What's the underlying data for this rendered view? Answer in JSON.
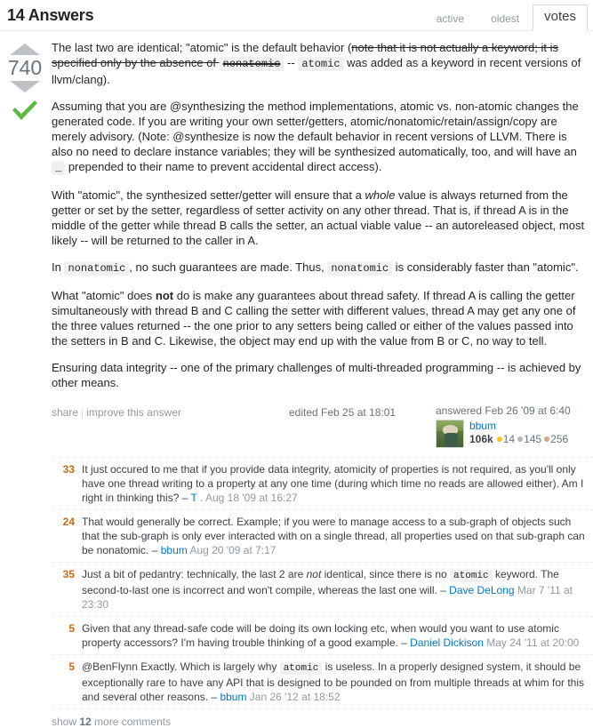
{
  "header": {
    "title": "14 Answers",
    "tabs": [
      {
        "label": "active",
        "active": false
      },
      {
        "label": "oldest",
        "active": false
      },
      {
        "label": "votes",
        "active": true
      }
    ]
  },
  "answer": {
    "vote_count": "740",
    "accepted": true,
    "accepted_color": "#5eba43",
    "paragraphs": {
      "p1_a": "The last two are identical; \"atomic\" is the default behavior (",
      "p1_strike_a": "note that it is not actually a keyword; it is specified only by the absence of ",
      "p1_strike_code": "nonatomic",
      "p1_b": " -- ",
      "p1_code": "atomic",
      "p1_c": " was added as a keyword in recent versions of llvm/clang).",
      "p2_a": "Assuming that you are @synthesizing the method implementations, atomic vs. non-atomic changes the generated code. If you are writing your own setter/getters, atomic/nonatomic/retain/assign/copy are merely advisory. (Note: @synthesize is now the default behavior in recent versions of LLVM. There is also no need to declare instance variables; they will be synthesized automatically, too, and will have an ",
      "p2_code": "_",
      "p2_b": " prepended to their name to prevent accidental direct access).",
      "p3_a": "With \"atomic\", the synthesized setter/getter will ensure that a ",
      "p3_ital": "whole",
      "p3_b": " value is always returned from the getter or set by the setter, regardless of setter activity on any other thread. That is, if thread A is in the middle of the getter while thread B calls the setter, an actual viable value -- an autoreleased object, most likely -- will be returned to the caller in A.",
      "p4_a": "In ",
      "p4_code1": "nonatomic",
      "p4_b": ", no such guarantees are made. Thus, ",
      "p4_code2": "nonatomic",
      "p4_c": " is considerably faster than \"atomic\".",
      "p5_a": "What \"atomic\" does ",
      "p5_bold": "not",
      "p5_b": " do is make any guarantees about thread safety. If thread A is calling the getter simultaneously with thread B and C calling the setter with different values, thread A may get any one of the three values returned -- the one prior to any setters being called or either of the values passed into the setters in B and C. Likewise, the object may end up with the value from B or C, no way to tell.",
      "p6": "Ensuring data integrity -- one of the primary challenges of multi-threaded programming -- is achieved by other means."
    },
    "footer": {
      "share_label": "share",
      "improve_label": "improve this answer",
      "edited_label": "edited Feb 25 at 18:01",
      "answered_label": "answered Feb 26 '09 at 6:40"
    },
    "user": {
      "name": "bbum",
      "reputation": "106k",
      "gold": "14",
      "silver": "145",
      "bronze": "256"
    }
  },
  "comments": [
    {
      "score": "33",
      "parts": [
        {
          "t": "text",
          "v": "It just occured to me that if you provide data integrity, atomicity of properties is not required, as you'll only have one thread writing to a property at any one time (during which time no reads are allowed either). Am I right in thinking this? "
        },
        {
          "t": "dash",
          "v": "– "
        },
        {
          "t": "user",
          "v": "T"
        },
        {
          "t": "date",
          "v": " . Aug 18 '09 at 16:27"
        }
      ]
    },
    {
      "score": "24",
      "parts": [
        {
          "t": "text",
          "v": "That would generally be correct. Example; if you were to manage access to a sub-graph of objects such that the sub-graph is only ever interacted with on a single thread, all properties used on that sub-graph can be nonatomic. "
        },
        {
          "t": "dash",
          "v": "– "
        },
        {
          "t": "user",
          "v": "bbum"
        },
        {
          "t": "date",
          "v": " Aug 20 '09 at 7:17"
        }
      ]
    },
    {
      "score": "35",
      "parts": [
        {
          "t": "text",
          "v": "Just a bit of pedantry: technically, the last 2 are "
        },
        {
          "t": "ital",
          "v": "not"
        },
        {
          "t": "text",
          "v": " identical, since there is no "
        },
        {
          "t": "code",
          "v": "atomic"
        },
        {
          "t": "text",
          "v": " keyword. The second-to-last one is incorrect and won't compile, whereas the last one will. "
        },
        {
          "t": "dash",
          "v": "– "
        },
        {
          "t": "user",
          "v": "Dave DeLong"
        },
        {
          "t": "date",
          "v": " Mar 7 '11 at 23:30"
        }
      ]
    },
    {
      "score": "5",
      "parts": [
        {
          "t": "text",
          "v": "Given that any thread-safe code will be doing its own locking etc, when would you want to use atomic property accessors? I'm having trouble thinking of a good example. "
        },
        {
          "t": "dash",
          "v": "– "
        },
        {
          "t": "user",
          "v": "Daniel Dickison"
        },
        {
          "t": "date",
          "v": " May 24 '11 at 20:00"
        }
      ]
    },
    {
      "score": "5",
      "parts": [
        {
          "t": "text",
          "v": "@BenFlynn Exactly. Which is largely why "
        },
        {
          "t": "code",
          "v": "atomic"
        },
        {
          "t": "text",
          "v": " is useless. In a properly designed system, it should be exceptionally rare to have any API that is designed to be pounded on from multiple threads at whim for this and several other reasons. "
        },
        {
          "t": "dash",
          "v": "– "
        },
        {
          "t": "user",
          "v": "bbum"
        },
        {
          "t": "date",
          "v": " Jan 26 '12 at 18:52"
        }
      ]
    }
  ],
  "show_more": {
    "prefix": "show ",
    "count": "12",
    "suffix": " more comments"
  }
}
